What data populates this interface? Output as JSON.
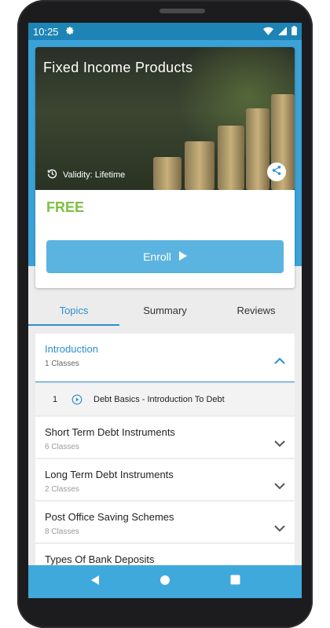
{
  "status_bar": {
    "time": "10:25"
  },
  "course": {
    "title": "Fixed Income Products",
    "validity": "Validity: Lifetime",
    "price": "FREE",
    "enroll_label": "Enroll"
  },
  "tabs": [
    {
      "label": "Topics",
      "active": true
    },
    {
      "label": "Summary",
      "active": false
    },
    {
      "label": "Reviews",
      "active": false
    }
  ],
  "sections": [
    {
      "title": "Introduction",
      "subtitle": "1 Classes",
      "expanded": true,
      "lessons": [
        {
          "number": "1",
          "title": "Debt Basics - Introduction To Debt"
        }
      ]
    },
    {
      "title": "Short Term Debt Instruments",
      "subtitle": "6 Classes",
      "expanded": false
    },
    {
      "title": "Long Term Debt Instruments",
      "subtitle": "2 Classes",
      "expanded": false
    },
    {
      "title": "Post Office Saving Schemes",
      "subtitle": "8 Classes",
      "expanded": false
    },
    {
      "title": "Types Of Bank Deposits",
      "subtitle": "",
      "expanded": false
    }
  ],
  "colors": {
    "status_bar": "#1d84b5",
    "header_band": "#3aa2d8",
    "accent": "#2a8fd0",
    "price": "#7cc142",
    "enroll_button": "#5bb3e0",
    "nav_bar": "#40a9dc"
  },
  "icons": {
    "status_left": "gear-icon",
    "status_right": [
      "wifi-icon",
      "signal-icon",
      "battery-icon"
    ],
    "validity": "history-icon",
    "share": "share-icon",
    "enroll": "play-triangle-icon",
    "lesson": "play-circle-icon",
    "nav": [
      "back-icon",
      "home-icon",
      "recents-icon"
    ]
  }
}
